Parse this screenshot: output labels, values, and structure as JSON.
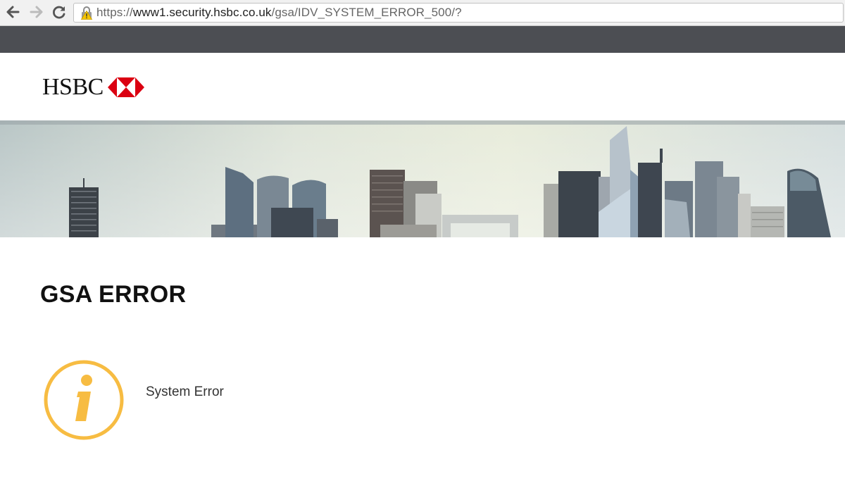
{
  "browser": {
    "url_scheme": "https://",
    "url_host": "www1.security.hsbc.co.uk",
    "url_path": "/gsa/IDV_SYSTEM_ERROR_500/?",
    "icons": {
      "back": "arrow-left-icon",
      "forward": "arrow-right-icon",
      "reload": "reload-icon",
      "security": "lock-warning-icon"
    }
  },
  "header": {
    "logo_text": "HSBC",
    "brand_red": "#db0011"
  },
  "main": {
    "title": "GSA ERROR",
    "message": "System Error",
    "info_icon": "info-icon",
    "info_color": "#f7bc42"
  },
  "colors": {
    "chrome_dark": "#4c4e53"
  }
}
